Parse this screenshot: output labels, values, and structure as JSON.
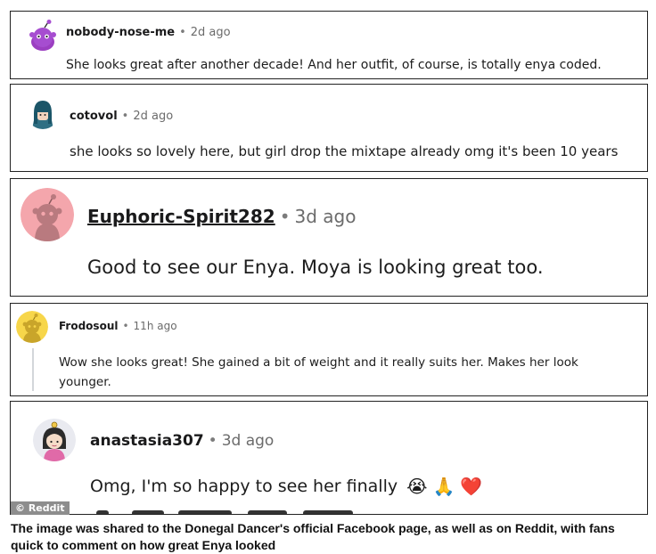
{
  "comments": [
    {
      "username": "nobody-nose-me",
      "time": "2d ago",
      "text": "She looks great after another decade! And her outfit, of course, is totally enya coded.",
      "avatar": "purple-snoo-avatar"
    },
    {
      "username": "cotovol",
      "time": "2d ago",
      "text": "she looks so lovely here, but girl drop the mixtape already omg it's been 10 years",
      "avatar": "teal-hair-avatar"
    },
    {
      "username": "Euphoric-Spirit282",
      "time": "3d ago",
      "text": "Good to see our Enya. Moya is looking great too.",
      "avatar": "pink-snoo-avatar"
    },
    {
      "username": "Frodosoul",
      "time": "11h ago",
      "text": "Wow she looks great! She gained a bit of weight and it really suits her. Makes her look younger.",
      "avatar": "yellow-snoo-avatar"
    },
    {
      "username": "anastasia307",
      "time": "3d ago",
      "text": "Omg,  I'm so happy to see her finally",
      "emojis": [
        "😭",
        "🙏",
        "❤️"
      ],
      "avatar": "girl-avatar"
    }
  ],
  "separator": "•",
  "watermark": "© Reddit",
  "caption": "The image was shared to the Donegal Dancer's official Facebook page, as well as on Reddit, with fans quick to comment on how great Enya looked",
  "colors": {
    "border": "#222222",
    "time": "#6b6b6b",
    "watermark_bg": "#8d8d8d"
  }
}
